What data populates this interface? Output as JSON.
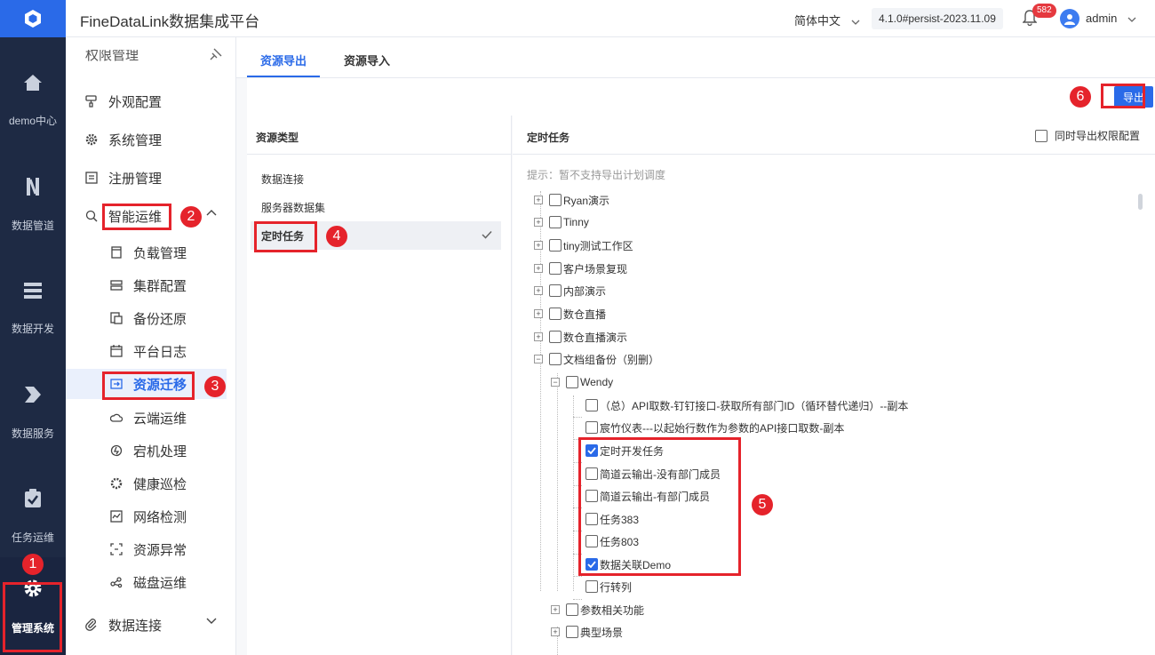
{
  "header": {
    "title": "FineDataLink数据集成平台",
    "language": "简体中文",
    "version": "4.1.0#persist-2023.11.09",
    "notification_count": "582",
    "user": "admin"
  },
  "rail": {
    "items": [
      {
        "label": "demo中心",
        "icon": "home-icon"
      },
      {
        "label": "数据管道",
        "icon": "pipeline-icon"
      },
      {
        "label": "数据开发",
        "icon": "develop-icon"
      },
      {
        "label": "数据服务",
        "icon": "service-icon"
      },
      {
        "label": "任务运维",
        "icon": "task-ops-icon"
      },
      {
        "label": "管理系统",
        "icon": "gear-icon"
      }
    ]
  },
  "sidebar": {
    "top_cut": "权限管理",
    "items": [
      {
        "label": "外观配置",
        "icon": "paint-icon"
      },
      {
        "label": "系统管理",
        "icon": "gear-icon"
      },
      {
        "label": "注册管理",
        "icon": "register-icon"
      },
      {
        "label": "智能运维",
        "icon": "ops-icon"
      },
      {
        "label": "负载管理",
        "icon": "load-icon"
      },
      {
        "label": "集群配置",
        "icon": "cluster-icon"
      },
      {
        "label": "备份还原",
        "icon": "backup-icon"
      },
      {
        "label": "平台日志",
        "icon": "log-icon"
      },
      {
        "label": "资源迁移",
        "icon": "migrate-icon"
      },
      {
        "label": "云端运维",
        "icon": "cloud-icon"
      },
      {
        "label": "宕机处理",
        "icon": "crash-icon"
      },
      {
        "label": "健康巡检",
        "icon": "health-icon"
      },
      {
        "label": "网络检测",
        "icon": "network-icon"
      },
      {
        "label": "资源异常",
        "icon": "resource-error-icon"
      },
      {
        "label": "磁盘运维",
        "icon": "disk-icon"
      },
      {
        "label": "数据连接",
        "icon": "link-icon"
      }
    ]
  },
  "tabs": {
    "export": "资源导出",
    "import": "资源导入"
  },
  "toolbar": {
    "export_label": "导出"
  },
  "resource_types": {
    "heading": "资源类型",
    "items": [
      "数据连接",
      "服务器数据集",
      "定时任务"
    ]
  },
  "schedule": {
    "heading": "定时任务",
    "option": "同时导出权限配置",
    "tip": "提示：暂不支持导出计划调度",
    "tree": [
      {
        "label": "Ryan演示",
        "toggle": "+",
        "checked": false
      },
      {
        "label": "Tinny",
        "toggle": "+",
        "checked": false
      },
      {
        "label": "tiny测试工作区",
        "toggle": "+",
        "checked": false
      },
      {
        "label": "客户场景复现",
        "toggle": "+",
        "checked": false
      },
      {
        "label": "内部演示",
        "toggle": "+",
        "checked": false
      },
      {
        "label": "数仓直播",
        "toggle": "+",
        "checked": false
      },
      {
        "label": "数仓直播演示",
        "toggle": "+",
        "checked": false
      },
      {
        "label": "文档组备份（别删）",
        "toggle": "−",
        "checked": false
      },
      {
        "label": "Wendy",
        "toggle": "−",
        "checked": false
      },
      {
        "label": "（总）API取数-钉钉接口-获取所有部门ID（循环替代递归）--副本",
        "checked": false
      },
      {
        "label": "宸竹仪表---以起始行数作为参数的API接口取数-副本",
        "checked": false
      },
      {
        "label": "定时开发任务",
        "checked": true
      },
      {
        "label": "简道云输出-没有部门成员",
        "checked": false
      },
      {
        "label": "简道云输出-有部门成员",
        "checked": false
      },
      {
        "label": "任务383",
        "checked": false
      },
      {
        "label": "任务803",
        "checked": false
      },
      {
        "label": "数据关联Demo",
        "checked": true
      },
      {
        "label": "行转列",
        "checked": false
      },
      {
        "label": "参数相关功能",
        "toggle": "+",
        "checked": false
      },
      {
        "label": "典型场景",
        "toggle": "+",
        "checked": false
      }
    ]
  },
  "annotations": [
    "1",
    "2",
    "3",
    "4",
    "5",
    "6"
  ],
  "colors": {
    "accent": "#2a6ae8",
    "annotation": "#e5232b",
    "rail": "#1e2a44"
  }
}
